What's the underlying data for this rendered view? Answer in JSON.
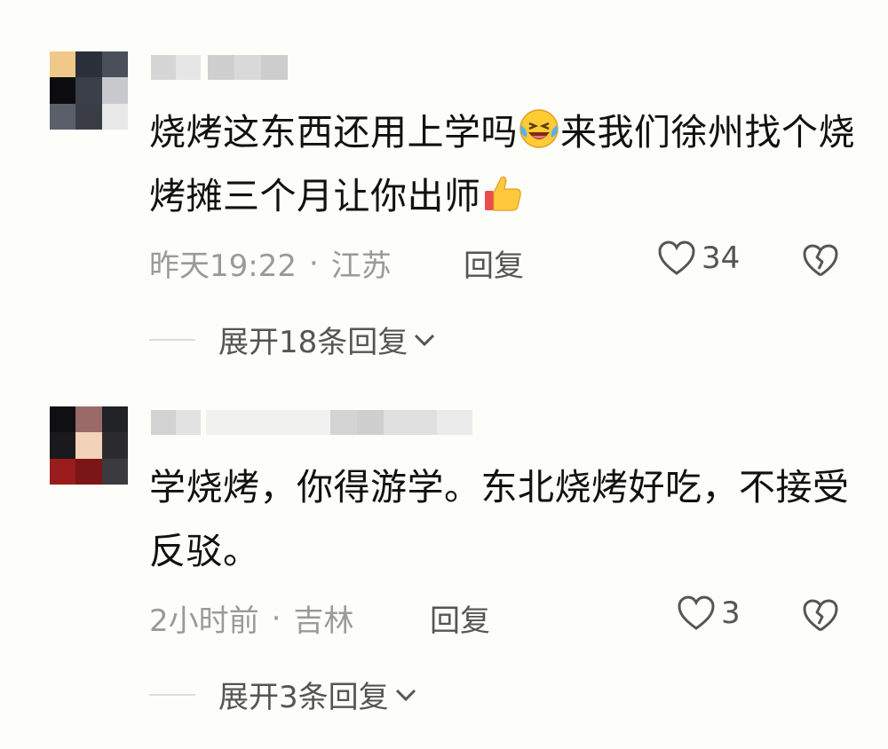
{
  "comments": [
    {
      "text_part1": "烧烤这东西还用上学吗",
      "text_part2": "来我们徐州找个烧烤摊三个月让你出师",
      "time": "昨天19:22",
      "location": "江苏",
      "reply_label": "回复",
      "likes": "34",
      "expand_label": "展开18条回复",
      "emoji1": "laughing-crying-emoji",
      "emoji2": "thumbs-up-emoji"
    },
    {
      "text": "学烧烤，你得游学。东北烧烤好吃，不接受反驳。",
      "time": "2小时前",
      "location": "吉林",
      "reply_label": "回复",
      "likes": "3",
      "expand_label": "展开3条回复"
    }
  ],
  "separator": "·",
  "icons": {
    "like": "heart-outline-icon",
    "dislike": "broken-heart-icon",
    "expand": "chevron-down-icon"
  }
}
